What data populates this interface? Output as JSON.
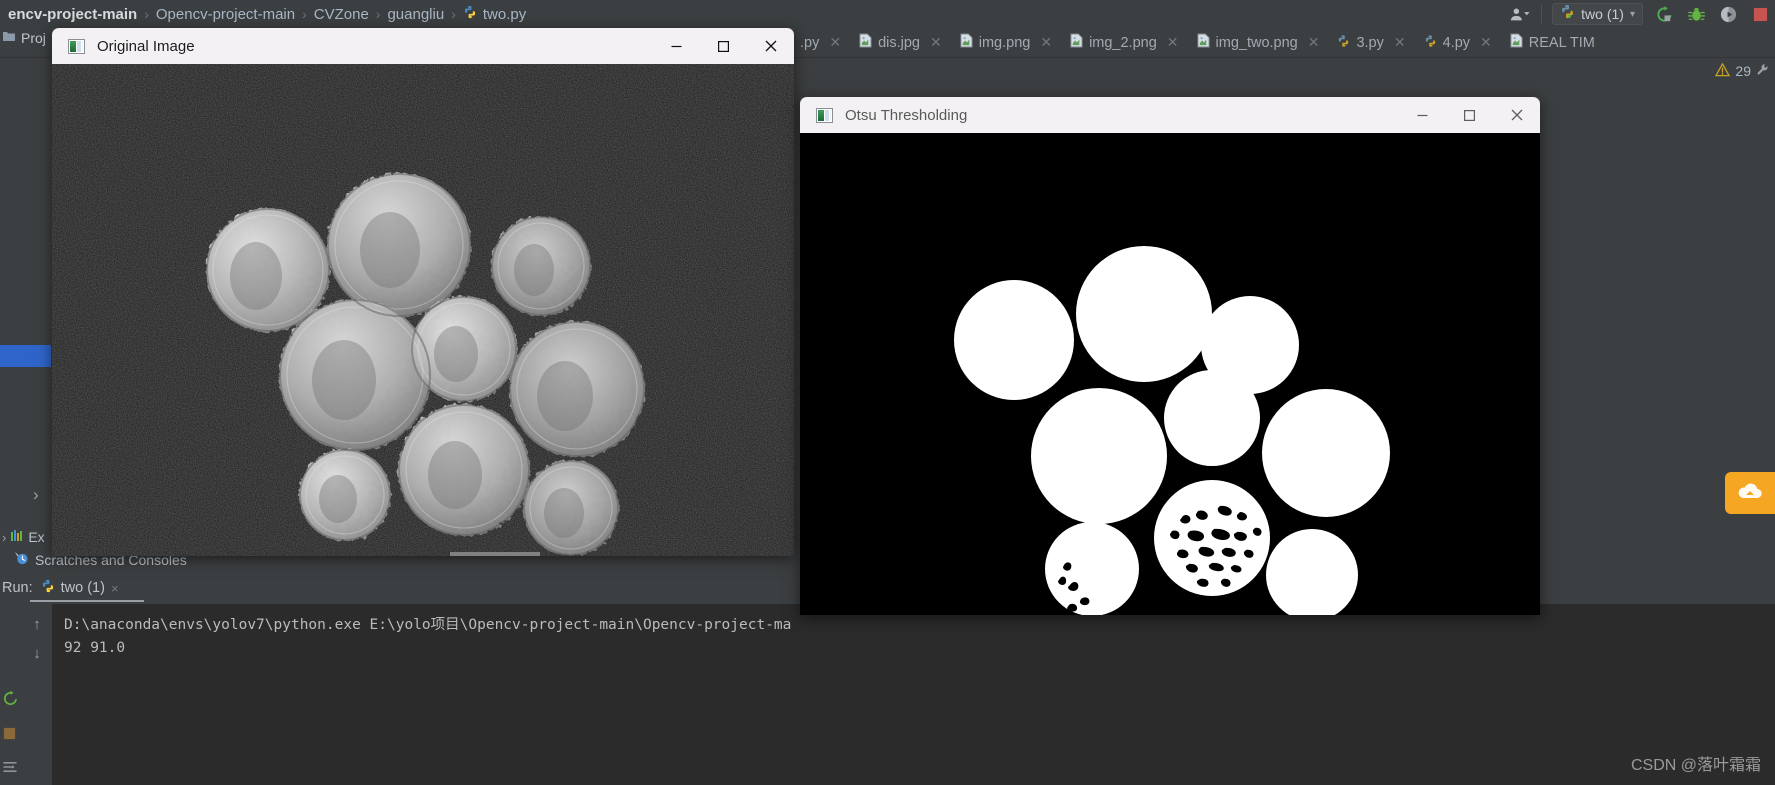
{
  "breadcrumb": {
    "items": [
      {
        "label": "encv-project-main",
        "icon": "none"
      },
      {
        "label": "Opencv-project-main",
        "icon": "none"
      },
      {
        "label": "CVZone",
        "icon": "none"
      },
      {
        "label": "guangliu",
        "icon": "none"
      },
      {
        "label": "two.py",
        "icon": "python-file-icon"
      }
    ],
    "separator": "›"
  },
  "toolbar": {
    "account_icon": "user-accounts-icon",
    "dropdown_caret": "▾",
    "run_config_label": "two (1)",
    "run_config_icon": "python-file-icon",
    "rerun_icon": "rerun-icon",
    "debug_icon": "debug-bug-icon",
    "coverage_icon": "run-coverage-icon",
    "stop_icon": "stop-icon"
  },
  "editor_tabs": [
    {
      "label": ".py",
      "icon": "python-file-icon",
      "closable": true
    },
    {
      "label": "dis.jpg",
      "icon": "image-file-icon",
      "closable": true
    },
    {
      "label": "img.png",
      "icon": "image-file-icon",
      "closable": true
    },
    {
      "label": "img_2.png",
      "icon": "image-file-icon",
      "closable": true
    },
    {
      "label": "img_two.png",
      "icon": "image-file-icon",
      "closable": true
    },
    {
      "label": "3.py",
      "icon": "python-file-icon",
      "closable": true
    },
    {
      "label": "4.py",
      "icon": "python-file-icon",
      "closable": true
    },
    {
      "label": "REAL TIM",
      "icon": "image-file-icon",
      "closable": false
    }
  ],
  "inspection": {
    "warning_icon": "warning-triangle-icon",
    "warning_count": "29",
    "extra_icon": "wrench-icon"
  },
  "sidebar": {
    "project_label": "Proj",
    "project_icon": "project-folder-icon",
    "expand_chevron": "›",
    "external_libs_label": "Ex",
    "external_libs_icon": "libraries-icon",
    "scratches_label": "Scratches and Consoles",
    "scratches_icon": "scratches-icon"
  },
  "run_panel": {
    "run_label": "Run:",
    "tab_label": "two (1)",
    "tab_icon": "python-file-icon",
    "tab_close": "×",
    "scroll_up_icon": "arrow-up-icon",
    "scroll_down_icon": "arrow-down-icon",
    "soft_wrap_icon": "soft-wrap-icon",
    "console_lines": [
      "D:\\anaconda\\envs\\yolov7\\python.exe E:\\yolo项目\\Opencv-project-main\\Opencv-project-ma",
      "92 91.0"
    ]
  },
  "windows": [
    {
      "id": "original-image",
      "title": "Original Image",
      "icon": "opencv-image-icon",
      "minimize_label": "—",
      "maximize_label": "□",
      "close_label": "✕",
      "content_description": "Grayscale photograph of nine coins on a dark textured background"
    },
    {
      "id": "otsu-thresholding",
      "title": "Otsu Thresholding",
      "icon": "opencv-image-icon",
      "minimize_label": "—",
      "maximize_label": "□",
      "close_label": "✕",
      "content_description": "Binary mask of nine coins rendered white on black after Otsu thresholding"
    }
  ],
  "notification": {
    "count": "1",
    "icon": "notification-cloud-icon"
  },
  "watermark": "CSDN @落叶霜霜",
  "colors": {
    "ide_background": "#3c3f41",
    "console_background": "#2b2b2b",
    "text_primary": "#a9b7c6",
    "accent_blue": "#2f65ca",
    "badge_orange": "#f5a623",
    "stop_red": "#c75450",
    "debug_green": "#62b543"
  }
}
